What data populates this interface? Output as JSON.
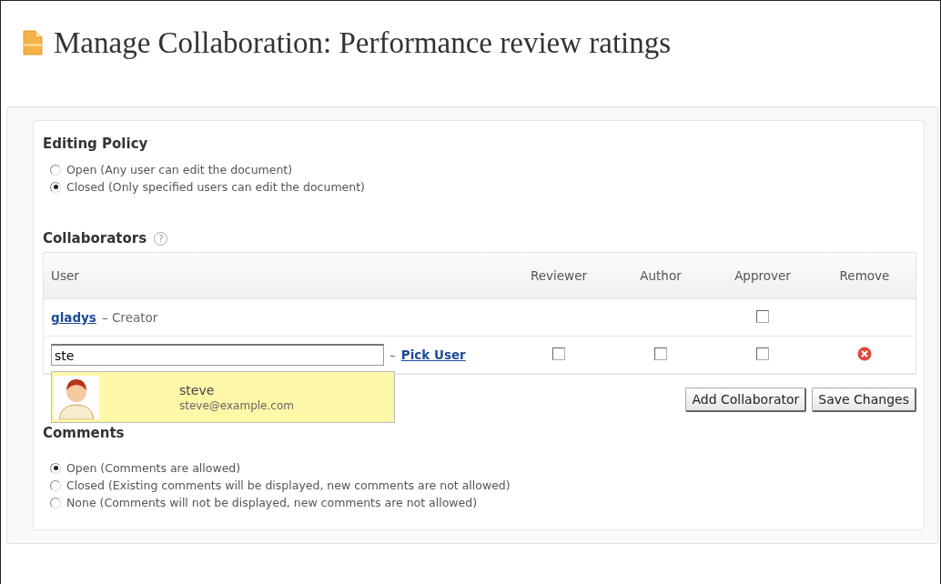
{
  "title": "Manage Collaboration: Performance review ratings",
  "editing_policy": {
    "heading": "Editing Policy",
    "options": [
      {
        "label": "Open (Any user can edit the document)",
        "selected": false
      },
      {
        "label": "Closed (Only specified users can edit the document)",
        "selected": true
      }
    ]
  },
  "collaborators": {
    "heading": "Collaborators",
    "help_icon": "?",
    "columns": [
      "User",
      "Reviewer",
      "Author",
      "Approver",
      "Remove"
    ],
    "rows": [
      {
        "kind": "user",
        "user": "gladys",
        "role": "– Creator",
        "reviewer": null,
        "author": null,
        "approver": {
          "checked": false
        },
        "removable": false
      },
      {
        "kind": "entry",
        "value": "ste",
        "pick_label": "Pick User",
        "separator": "–",
        "reviewer": {
          "checked": false
        },
        "author": {
          "checked": false
        },
        "approver": {
          "checked": false
        },
        "removable": true
      }
    ],
    "suggestion": {
      "name": "steve",
      "email": "steve@example.com"
    },
    "buttons": [
      "Add Collaborator",
      "Save Changes"
    ]
  },
  "comments": {
    "heading": "Comments",
    "options": [
      {
        "label": "Open (Comments are allowed)",
        "selected": true
      },
      {
        "label": "Closed (Existing comments will be displayed, new comments are not allowed)",
        "selected": false
      },
      {
        "label": "None (Comments will not be displayed, new comments are not allowed)",
        "selected": false
      }
    ]
  }
}
